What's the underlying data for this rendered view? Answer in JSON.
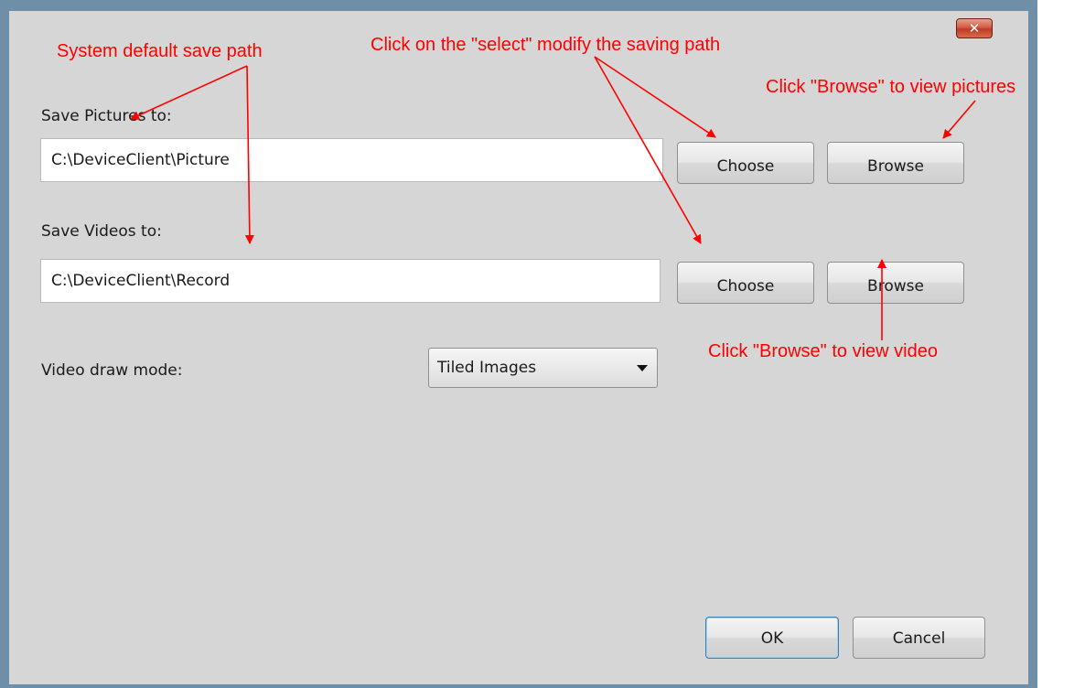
{
  "dialog": {
    "close_glyph": "✕",
    "pictures_label": "Save Pictures to:",
    "pictures_path": "C:\\DeviceClient\\Picture",
    "videos_label": "Save Videos to:",
    "videos_path": "C:\\DeviceClient\\Record",
    "choose_label": "Choose",
    "browse_label": "Browse",
    "draw_mode_label": "Video draw mode:",
    "draw_mode_value": "Tiled Images",
    "ok_label": "OK",
    "cancel_label": "Cancel"
  },
  "annotations": {
    "default_path": "System default save path",
    "select_modify": "Click on the \"select\" modify the saving path",
    "browse_pictures": "Click \"Browse\" to view pictures",
    "browse_video": "Click \"Browse\" to view video",
    "color": "#ff0000"
  },
  "colors": {
    "dialog_bg": "#d6d6d6",
    "frame": "#6f8fa9",
    "close_button": "#c8452f"
  }
}
